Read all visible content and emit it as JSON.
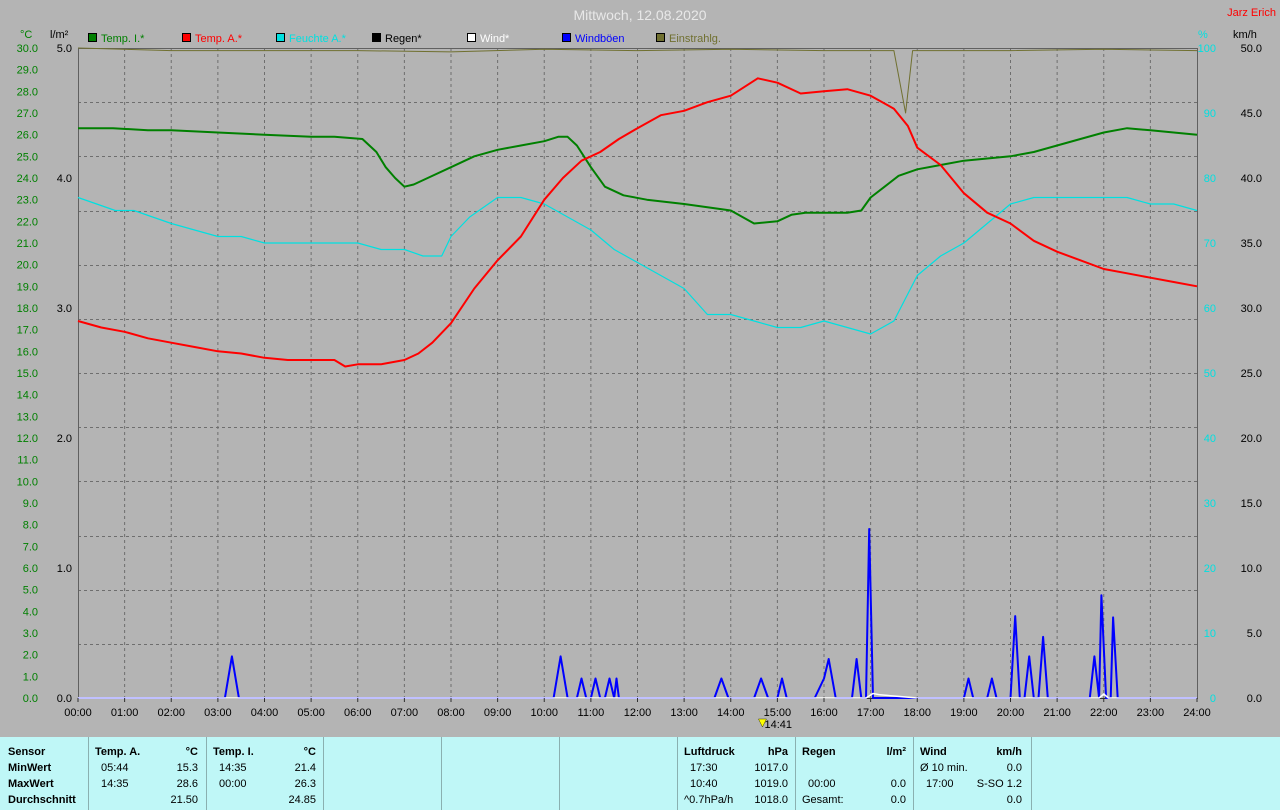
{
  "title": "Mittwoch, 12.08.2020",
  "author": "Jarz Erich",
  "colors": {
    "background": "#b4b4b4",
    "plot_bg": "#b4b4b4",
    "grid": "#6e6e6e",
    "temp_i": "#008000",
    "temp_a": "#ff0000",
    "feuchte": "#00e0e0",
    "regen": "#000000",
    "wind": "#ffffff",
    "windboeen": "#0000ff",
    "einstrahlung": "#707030",
    "panel_bg": "#bff7f7"
  },
  "chart_data": {
    "type": "line",
    "title": "Mittwoch, 12.08.2020",
    "x_ticks": [
      "00:00",
      "01:00",
      "02:00",
      "03:00",
      "04:00",
      "05:00",
      "06:00",
      "07:00",
      "08:00",
      "09:00",
      "10:00",
      "11:00",
      "12:00",
      "13:00",
      "14:00",
      "15:00",
      "16:00",
      "17:00",
      "18:00",
      "19:00",
      "20:00",
      "21:00",
      "22:00",
      "23:00",
      "24:00"
    ],
    "xlim_hours": [
      0,
      24
    ],
    "axes": {
      "temp": {
        "unit": "°C",
        "range": [
          0,
          30
        ],
        "ticks": [
          "0.0",
          "1.0",
          "2.0",
          "3.0",
          "4.0",
          "5.0",
          "6.0",
          "7.0",
          "8.0",
          "9.0",
          "10.0",
          "11.0",
          "12.0",
          "13.0",
          "14.0",
          "15.0",
          "16.0",
          "17.0",
          "18.0",
          "19.0",
          "20.0",
          "21.0",
          "22.0",
          "23.0",
          "24.0",
          "25.0",
          "26.0",
          "27.0",
          "28.0",
          "29.0",
          "30.0"
        ]
      },
      "rain": {
        "unit": "l/m²",
        "range": [
          0,
          5
        ],
        "ticks": [
          "0.0",
          "1.0",
          "2.0",
          "3.0",
          "4.0",
          "5.0"
        ]
      },
      "humidity": {
        "unit": "%",
        "range": [
          0,
          100
        ],
        "ticks": [
          "0",
          "10",
          "20",
          "30",
          "40",
          "50",
          "60",
          "70",
          "80",
          "90",
          "100"
        ]
      },
      "wind": {
        "unit": "km/h",
        "range": [
          0,
          50
        ],
        "ticks": [
          "0.0",
          "5.0",
          "10.0",
          "15.0",
          "20.0",
          "25.0",
          "30.0",
          "35.0",
          "40.0",
          "45.0",
          "50.0"
        ]
      }
    },
    "legend": [
      {
        "name": "Temp. I.*",
        "color": "#008000"
      },
      {
        "name": "Temp. A.*",
        "color": "#ff0000"
      },
      {
        "name": "Feuchte A.*",
        "color": "#00e0e0"
      },
      {
        "name": "Regen*",
        "color": "#000000"
      },
      {
        "name": "Wind*",
        "color": "#ffffff"
      },
      {
        "name": "Windböen",
        "color": "#0000ff"
      },
      {
        "name": "Einstrahlg.",
        "color": "#707030"
      }
    ],
    "series": [
      {
        "name": "Temp. I.*",
        "axis": "temp",
        "color": "#008000",
        "x": [
          0,
          0.75,
          1.5,
          2,
          3,
          4,
          5,
          5.5,
          6.1,
          6.4,
          6.6,
          6.8,
          7,
          7.2,
          7.5,
          8,
          8.5,
          9,
          9.5,
          10,
          10.3,
          10.5,
          10.7,
          11,
          11.3,
          11.7,
          12.2,
          13,
          14,
          14.5,
          15,
          15.3,
          15.6,
          16,
          16.5,
          16.8,
          17,
          17.3,
          17.6,
          18,
          18.5,
          19,
          19.5,
          20,
          20.5,
          21,
          21.5,
          22,
          22.5,
          23,
          23.5,
          24
        ],
        "y": [
          26.3,
          26.3,
          26.2,
          26.2,
          26.1,
          26.0,
          25.9,
          25.9,
          25.8,
          25.2,
          24.5,
          24.0,
          23.6,
          23.7,
          24.0,
          24.5,
          25.0,
          25.3,
          25.5,
          25.7,
          25.9,
          25.9,
          25.5,
          24.5,
          23.6,
          23.2,
          23.0,
          22.8,
          22.5,
          21.9,
          22.0,
          22.3,
          22.4,
          22.4,
          22.4,
          22.5,
          23.1,
          23.6,
          24.1,
          24.4,
          24.6,
          24.8,
          24.9,
          25.0,
          25.2,
          25.5,
          25.8,
          26.1,
          26.3,
          26.2,
          26.1,
          26.0
        ]
      },
      {
        "name": "Temp. A.*",
        "axis": "temp",
        "color": "#ff0000",
        "x": [
          0,
          0.5,
          1,
          1.5,
          2,
          2.5,
          3,
          3.5,
          4,
          4.5,
          5,
          5.5,
          5.73,
          6,
          6.5,
          7,
          7.3,
          7.6,
          8,
          8.5,
          9,
          9.5,
          10,
          10.4,
          10.8,
          11.2,
          11.6,
          12,
          12.5,
          13,
          13.5,
          14,
          14.58,
          15,
          15.5,
          16,
          16.5,
          17,
          17.5,
          17.8,
          18,
          18.5,
          19,
          19.5,
          20,
          20.5,
          21,
          21.5,
          22,
          22.5,
          23,
          23.5,
          24
        ],
        "y": [
          17.4,
          17.1,
          16.9,
          16.6,
          16.4,
          16.2,
          16.0,
          15.9,
          15.7,
          15.6,
          15.6,
          15.6,
          15.3,
          15.4,
          15.4,
          15.6,
          15.9,
          16.4,
          17.3,
          18.9,
          20.2,
          21.3,
          23.0,
          24.0,
          24.8,
          25.2,
          25.8,
          26.3,
          26.9,
          27.1,
          27.5,
          27.8,
          28.6,
          28.4,
          27.9,
          28.0,
          28.1,
          27.8,
          27.2,
          26.4,
          25.4,
          24.6,
          23.3,
          22.4,
          21.9,
          21.1,
          20.6,
          20.2,
          19.8,
          19.6,
          19.4,
          19.2,
          19.0
        ]
      },
      {
        "name": "Feuchte A.*",
        "axis": "humidity",
        "color": "#00e0e0",
        "x": [
          0,
          0.4,
          0.8,
          1.2,
          1.6,
          2,
          2.5,
          3,
          3.5,
          4,
          4.5,
          5,
          5.5,
          6,
          6.5,
          7,
          7.4,
          7.8,
          8,
          8.4,
          8.8,
          9,
          9.5,
          10,
          10.5,
          11,
          11.5,
          12,
          12.5,
          13,
          13.5,
          14,
          14.5,
          15,
          15.5,
          16,
          16.5,
          17,
          17.5,
          18,
          18.5,
          19,
          19.5,
          20,
          20.5,
          21,
          21.5,
          22,
          22.5,
          23,
          23.5,
          24
        ],
        "y": [
          77,
          76,
          75,
          75,
          74,
          73,
          72,
          71,
          71,
          70,
          70,
          70,
          70,
          70,
          69,
          69,
          68,
          68,
          71,
          74,
          76,
          77,
          77,
          76,
          74,
          72,
          69,
          67,
          65,
          63,
          59,
          59,
          58,
          57,
          57,
          58,
          57,
          56,
          58,
          65,
          68,
          70,
          73,
          76,
          77,
          77,
          77,
          77,
          77,
          76,
          76,
          75
        ]
      },
      {
        "name": "Einstrahlg.",
        "axis": "rain",
        "color": "#707030",
        "x": [
          0,
          2,
          4,
          6,
          8,
          10,
          12,
          14,
          16,
          17.5,
          17.75,
          17.9,
          18,
          20,
          22,
          24
        ],
        "y": [
          5.0,
          4.98,
          4.98,
          4.98,
          4.97,
          4.99,
          4.98,
          4.99,
          4.98,
          4.98,
          4.5,
          4.98,
          4.98,
          4.98,
          4.99,
          4.98
        ]
      },
      {
        "name": "Windböen",
        "axis": "wind",
        "color": "#0000ff",
        "x": [
          0,
          3.15,
          3.3,
          3.45,
          10.2,
          10.35,
          10.5,
          10.7,
          10.8,
          10.9,
          11.0,
          11.1,
          11.2,
          11.3,
          11.4,
          11.5,
          11.55,
          11.6,
          11.7,
          13.65,
          13.8,
          13.95,
          14.5,
          14.65,
          14.8,
          15.0,
          15.1,
          15.2,
          15.8,
          16.0,
          16.1,
          16.25,
          16.6,
          16.7,
          16.8,
          16.9,
          16.97,
          17.05,
          19.0,
          19.1,
          19.2,
          19.5,
          19.6,
          19.7,
          19.9,
          20.0,
          20.1,
          20.2,
          20.3,
          20.4,
          20.5,
          20.6,
          20.7,
          20.8,
          21.7,
          21.8,
          21.9,
          21.95,
          22.05,
          22.15,
          22.2,
          22.3,
          22.4,
          24
        ],
        "y": [
          0,
          0,
          3.2,
          0,
          0,
          3.2,
          0,
          0,
          1.5,
          0,
          0,
          1.5,
          0,
          0,
          1.5,
          0,
          1.5,
          0,
          0,
          0,
          1.5,
          0,
          0,
          1.5,
          0,
          0,
          1.5,
          0,
          0,
          1.5,
          3.0,
          0,
          0,
          3.0,
          0,
          0,
          13.0,
          0,
          0,
          1.5,
          0,
          0,
          1.5,
          0,
          0,
          0,
          6.3,
          0,
          0,
          3.2,
          0,
          0,
          4.7,
          0,
          0,
          3.2,
          0,
          7.9,
          0,
          0,
          6.2,
          0,
          0,
          0
        ]
      },
      {
        "name": "Wind*",
        "axis": "wind",
        "color": "#ffffff",
        "x": [
          0,
          16.9,
          17.05,
          17.2,
          17.5,
          18,
          21.9,
          22.0,
          22.1,
          24
        ],
        "y": [
          0,
          0,
          0.35,
          0.25,
          0.15,
          0,
          0,
          0.3,
          0,
          0
        ]
      }
    ],
    "annotation": {
      "label": "14:41",
      "x_hours": 14.68
    }
  },
  "stats": {
    "col_sensor": {
      "header": "Sensor",
      "rows": [
        "MinWert",
        "MaxWert",
        "Durchschnitt"
      ]
    },
    "temp_a": {
      "header": "Temp. A.",
      "unit": "°C",
      "min_time": "05:44",
      "min": "15.3",
      "max_time": "14:35",
      "max": "28.6",
      "avg": "21.50"
    },
    "temp_i": {
      "header": "Temp. I.",
      "unit": "°C",
      "min_time": "14:35",
      "min": "21.4",
      "max_time": "00:00",
      "max": "26.3",
      "avg": "24.85"
    },
    "pressure": {
      "header": "Luftdruck",
      "unit": "hPa",
      "min_time": "17:30",
      "min": "1017.0",
      "max_time": "10:40",
      "max": "1019.0",
      "trend_label": "^0.7hPa/h",
      "trend_value": "1018.0"
    },
    "rain": {
      "header": "Regen",
      "unit": "l/m²",
      "max_time": "00:00",
      "max": "0.0",
      "total_label": "Gesamt:",
      "total": "0.0"
    },
    "wind": {
      "header": "Wind",
      "unit": "km/h",
      "avg_label": "Ø 10 min.",
      "avg": "0.0",
      "max_time": "17:00",
      "max": "S-SO 1.2",
      "total": "0.0"
    }
  }
}
